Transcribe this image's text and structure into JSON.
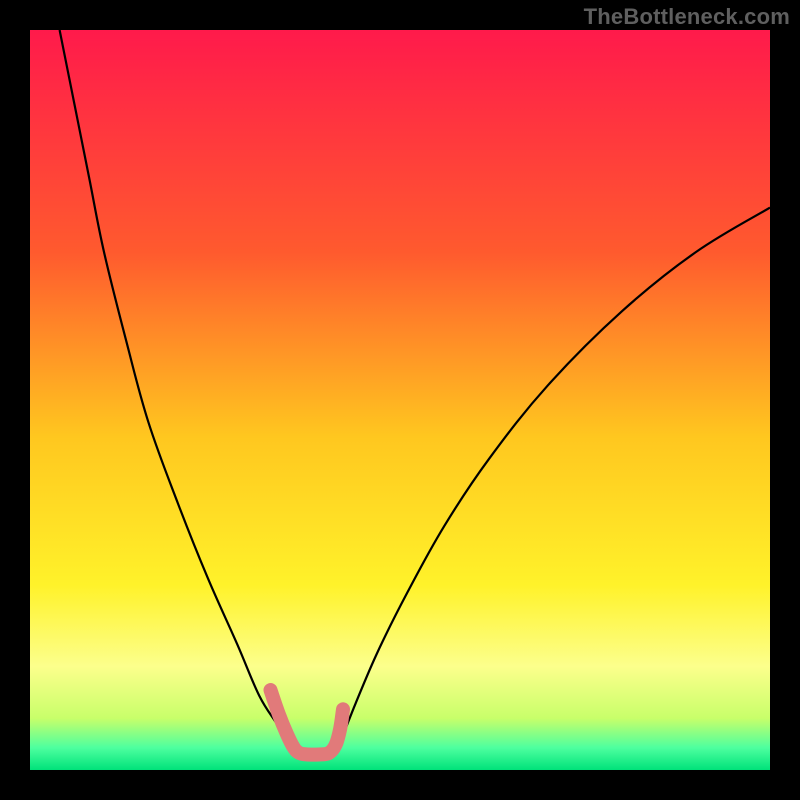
{
  "attribution": "TheBottleneck.com",
  "chart_data": {
    "type": "line",
    "title": "",
    "xlabel": "",
    "ylabel": "",
    "xlim": [
      0,
      100
    ],
    "ylim": [
      0,
      100
    ],
    "background_gradient": {
      "stops": [
        {
          "offset": 0.0,
          "color": "#ff1a4b"
        },
        {
          "offset": 0.3,
          "color": "#ff5a2e"
        },
        {
          "offset": 0.55,
          "color": "#ffc71f"
        },
        {
          "offset": 0.75,
          "color": "#fff22a"
        },
        {
          "offset": 0.86,
          "color": "#fcff8c"
        },
        {
          "offset": 0.93,
          "color": "#c8ff6a"
        },
        {
          "offset": 0.97,
          "color": "#4dff9f"
        },
        {
          "offset": 1.0,
          "color": "#00e27a"
        }
      ]
    },
    "series": [
      {
        "name": "left-branch",
        "color": "#000000",
        "width": 2.2,
        "x": [
          4,
          6,
          8,
          10,
          13,
          16,
          20,
          24,
          28,
          31,
          33.5,
          35,
          35.5
        ],
        "y": [
          100,
          90,
          80,
          70,
          58,
          47,
          36,
          26,
          17,
          10,
          6,
          3.2,
          2.3
        ]
      },
      {
        "name": "right-branch",
        "color": "#000000",
        "width": 2.2,
        "x": [
          41,
          42,
          44,
          47,
          51,
          56,
          62,
          70,
          80,
          90,
          100
        ],
        "y": [
          2.3,
          4,
          9,
          16,
          24,
          33,
          42,
          52,
          62,
          70,
          76
        ]
      },
      {
        "name": "valley-marker",
        "color": "#e17a7a",
        "width": 14,
        "linecap": "round",
        "x": [
          32.5,
          33.6,
          34.7,
          35.6,
          36.4,
          37.6,
          39.0,
          40.4,
          41.3,
          41.9,
          42.3
        ],
        "y": [
          10.8,
          7.6,
          4.9,
          3.1,
          2.3,
          2.1,
          2.1,
          2.3,
          3.4,
          5.5,
          8.2
        ]
      }
    ]
  }
}
